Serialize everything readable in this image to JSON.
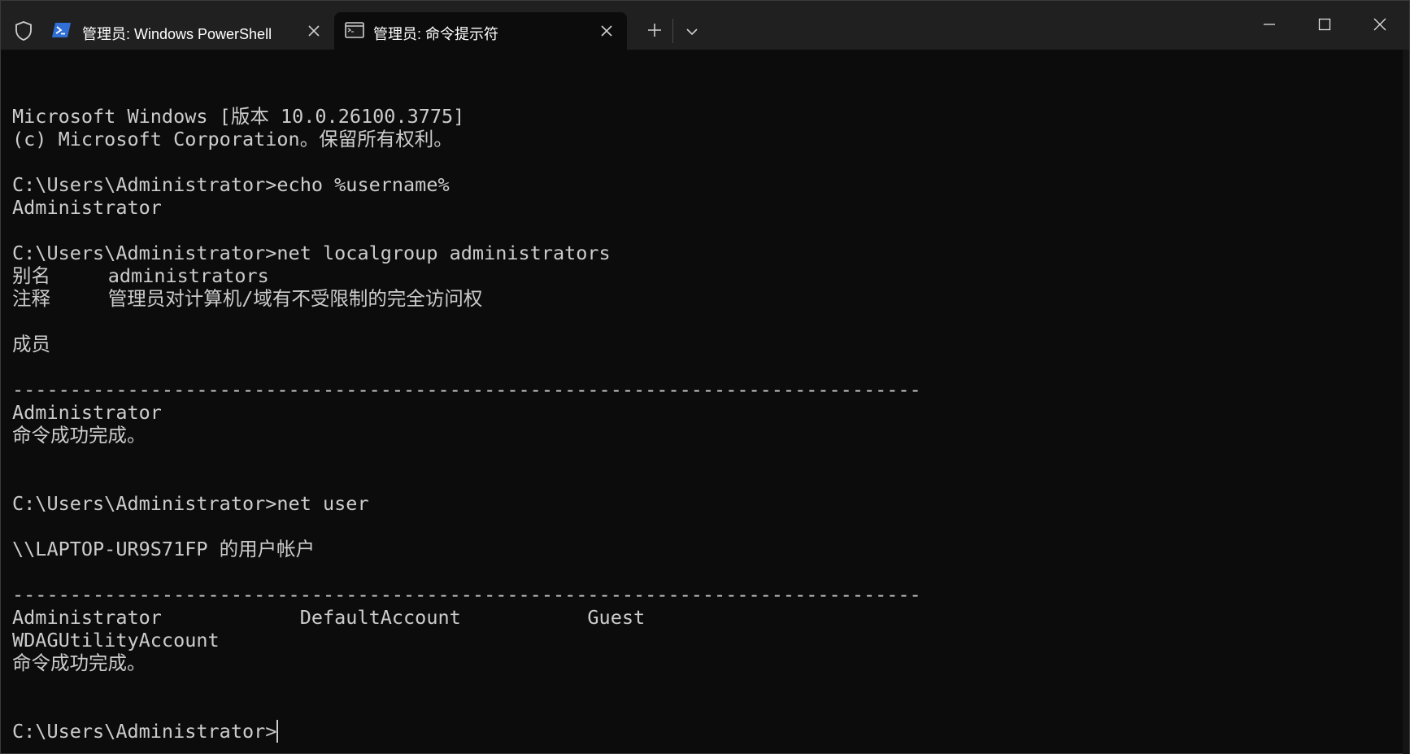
{
  "tabs": [
    {
      "label": "管理员: Windows PowerShell",
      "icon": "powershell-icon",
      "active": false
    },
    {
      "label": "管理员: 命令提示符",
      "icon": "cmd-icon",
      "active": true
    }
  ],
  "console": {
    "lines": [
      "Microsoft Windows [版本 10.0.26100.3775]",
      "(c) Microsoft Corporation。保留所有权利。",
      "",
      "C:\\Users\\Administrator>echo %username%",
      "Administrator",
      "",
      "C:\\Users\\Administrator>net localgroup administrators",
      "别名     administrators",
      "注释     管理员对计算机/域有不受限制的完全访问权",
      "",
      "成员",
      "",
      "-------------------------------------------------------------------------------",
      "Administrator",
      "命令成功完成。",
      "",
      "",
      "C:\\Users\\Administrator>net user",
      "",
      "\\\\LAPTOP-UR9S71FP 的用户帐户",
      "",
      "-------------------------------------------------------------------------------",
      "Administrator            DefaultAccount           Guest",
      "WDAGUtilityAccount",
      "命令成功完成。",
      "",
      ""
    ],
    "prompt": "C:\\Users\\Administrator>"
  },
  "colors": {
    "background": "#0c0c0c",
    "titlebar": "#202020",
    "text": "#cccccc"
  }
}
